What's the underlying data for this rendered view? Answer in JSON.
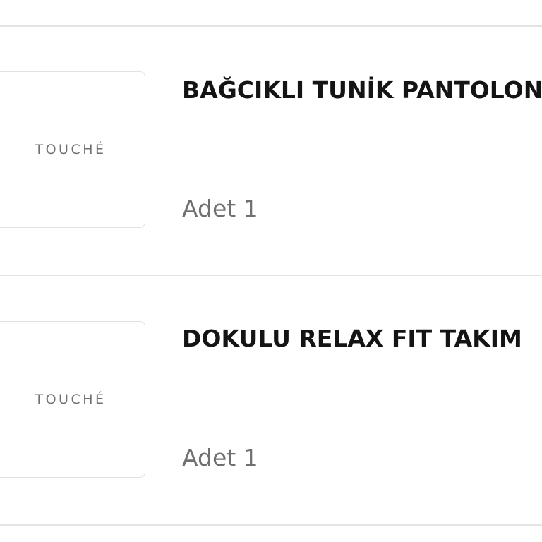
{
  "items": [
    {
      "brand_logo": "TOUCHÉ",
      "title": "BAĞCIKLI TUNİK PANTOLON TAKIM",
      "quantity": "Adet 1"
    },
    {
      "brand_logo": "TOUCHÉ",
      "title": "DOKULU RELAX FIT TAKIM",
      "quantity": "Adet 1"
    }
  ]
}
